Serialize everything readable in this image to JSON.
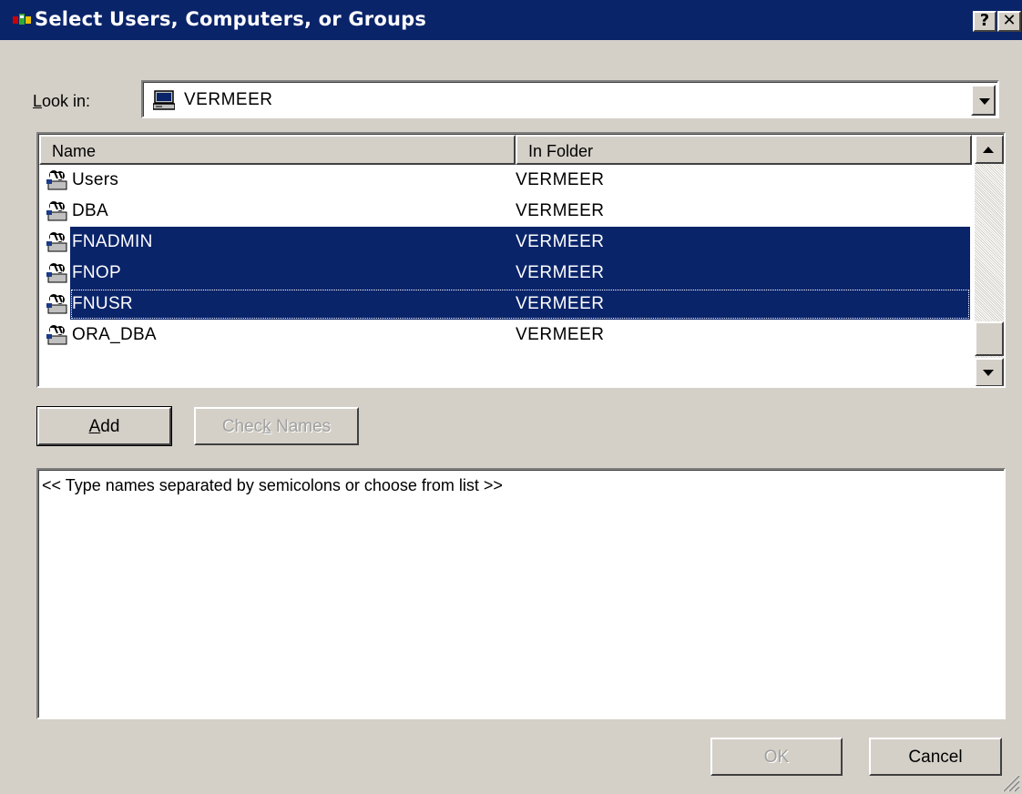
{
  "window": {
    "title": "Select Users, Computers, or Groups",
    "help_glyph": "?",
    "close_glyph": "✕"
  },
  "look_in": {
    "label_underlined": "L",
    "label_rest": "ook in:",
    "value": "VERMEER",
    "icon": "computer-icon"
  },
  "list": {
    "columns": [
      "Name",
      "In Folder"
    ],
    "rows": [
      {
        "name": "Users",
        "folder": "VERMEER",
        "icon": "group-icon",
        "selected": false
      },
      {
        "name": "DBA",
        "folder": "VERMEER",
        "icon": "group-icon",
        "selected": false
      },
      {
        "name": "FNADMIN",
        "folder": "VERMEER",
        "icon": "group-icon",
        "selected": true
      },
      {
        "name": "FNOP",
        "folder": "VERMEER",
        "icon": "group-icon",
        "selected": true
      },
      {
        "name": "FNUSR",
        "folder": "VERMEER",
        "icon": "group-icon",
        "selected": true,
        "focused": true
      },
      {
        "name": "ORA_DBA",
        "folder": "VERMEER",
        "icon": "group-icon",
        "selected": false
      }
    ]
  },
  "buttons": {
    "add_underlined": "A",
    "add_rest": "dd",
    "check_pre": "Chec",
    "check_underlined": "k",
    "check_post": " Names",
    "ok": "OK",
    "cancel": "Cancel"
  },
  "names_box": {
    "text": "<< Type names separated by semicolons or choose from list >>"
  },
  "colors": {
    "titlebar": "#0a246a",
    "selection": "#0a246a",
    "face": "#d4d0c8"
  }
}
